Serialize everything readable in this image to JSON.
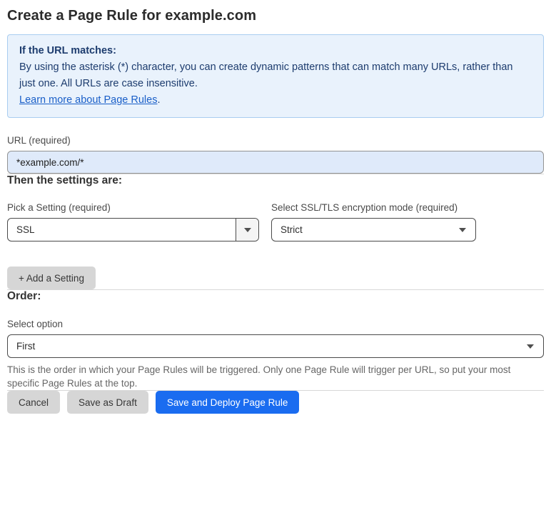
{
  "page": {
    "title": "Create a Page Rule for example.com"
  },
  "info_box": {
    "heading": "If the URL matches:",
    "body": "By using the asterisk (*) character, you can create dynamic patterns that can match many URLs, rather than just one. All URLs are case insensitive.",
    "link_label": "Learn more about Page Rules",
    "link_suffix": "."
  },
  "url_field": {
    "label": "URL (required)",
    "value": "*example.com/*"
  },
  "settings_section": {
    "heading": "Then the settings are:",
    "setting_select": {
      "label": "Pick a Setting (required)",
      "value": "SSL"
    },
    "mode_select": {
      "label": "Select SSL/TLS encryption mode (required)",
      "value": "Strict"
    },
    "add_setting_label": "+ Add a Setting"
  },
  "order_section": {
    "heading": "Order:",
    "select_label": "Select option",
    "select_value": "First",
    "help_text": "This is the order in which your Page Rules will be triggered. Only one Page Rule will trigger per URL, so put your most specific Page Rules at the top."
  },
  "footer": {
    "cancel_label": "Cancel",
    "save_draft_label": "Save as Draft",
    "save_deploy_label": "Save and Deploy Page Rule"
  },
  "icons": {
    "dropdown_arrow": "chevron-down-icon"
  },
  "colors": {
    "accent_blue": "#1a6cf0",
    "info_box_bg": "#e9f2fc",
    "info_box_border": "#a9cdf0",
    "info_text_navy": "#1d3c6e",
    "link_blue": "#1a5fc8",
    "url_input_bg": "#dfeafa",
    "gray_button_bg": "#d6d6d6",
    "select_border": "#4a4a4a",
    "divider": "#d8d8d8",
    "help_text_gray": "#666666"
  }
}
